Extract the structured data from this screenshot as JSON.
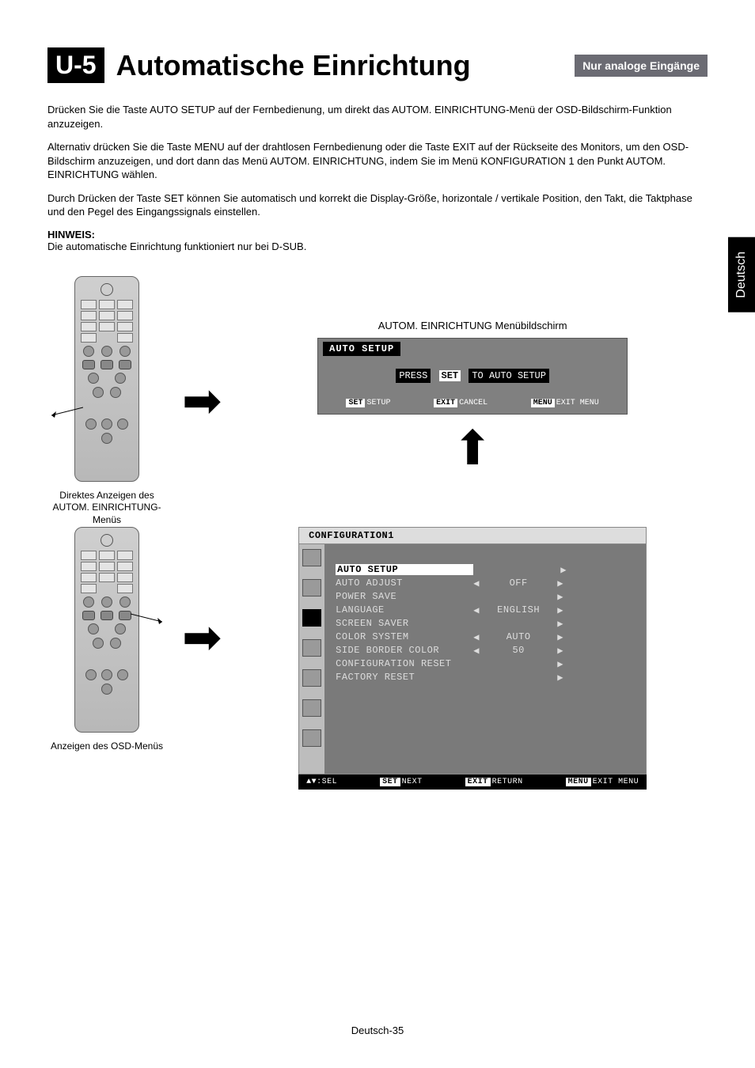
{
  "section_number": "U-5",
  "page_title": "Automatische Einrichtung",
  "tag": "Nur analoge Eingänge",
  "side_tab": "Deutsch",
  "paragraphs": [
    "Drücken Sie die Taste AUTO SETUP auf der Fernbedienung, um direkt das AUTOM. EINRICHTUNG-Menü der OSD-Bildschirm-Funktion anzuzeigen.",
    "Alternativ drücken Sie die Taste MENU auf der drahtlosen Fernbedienung oder die Taste EXIT auf der Rückseite des Monitors, um den OSD-Bildschirm anzuzeigen, und dort dann das Menü AUTOM. EINRICHTUNG, indem Sie im Menü KONFIGURATION 1 den Punkt AUTOM. EINRICHTUNG wählen.",
    "Durch Drücken der Taste SET können Sie automatisch und korrekt die Display-Größe, horizontale / vertikale Position, den Takt, die Taktphase und den Pegel des Eingangssignals einstellen."
  ],
  "notice_label": "HINWEIS:",
  "notice_text": "Die automatische Einrichtung funktioniert nur bei D-SUB.",
  "remote1_caption": "Direktes Anzeigen des AUTOM. EINRICHTUNG-Menüs",
  "remote2_caption": "Anzeigen des OSD-Menüs",
  "osd1_caption": "AUTOM. EINRICHTUNG Menübildschirm",
  "osd1": {
    "title": "AUTO SETUP",
    "body_press": "PRESS",
    "body_set": "SET",
    "body_to": "TO AUTO SETUP",
    "foot_set": "SET",
    "foot_set_lbl": "SETUP",
    "foot_exit": "EXIT",
    "foot_exit_lbl": "CANCEL",
    "foot_menu": "MENU",
    "foot_menu_lbl": "EXIT MENU"
  },
  "osd2": {
    "title": "CONFIGURATION1",
    "rows": [
      {
        "label": "AUTO SETUP",
        "left": "",
        "value": "",
        "right": "▶",
        "first": true
      },
      {
        "label": "AUTO ADJUST",
        "left": "◀",
        "value": "OFF",
        "right": "▶"
      },
      {
        "label": "POWER SAVE",
        "left": "",
        "value": "",
        "right": "▶"
      },
      {
        "label": "LANGUAGE",
        "left": "◀",
        "value": "ENGLISH",
        "right": "▶"
      },
      {
        "label": "SCREEN SAVER",
        "left": "",
        "value": "",
        "right": "▶"
      },
      {
        "label": "COLOR SYSTEM",
        "left": "◀",
        "value": "AUTO",
        "right": "▶"
      },
      {
        "label": "SIDE BORDER COLOR",
        "left": "◀",
        "value": "50",
        "right": "▶"
      },
      {
        "label": "CONFIGURATION RESET",
        "left": "",
        "value": "",
        "right": "▶"
      },
      {
        "label": "FACTORY RESET",
        "left": "",
        "value": "",
        "right": "▶"
      }
    ],
    "footer": {
      "sel_icon": "▲▼",
      "sel_lbl": "SEL",
      "set": "SET",
      "set_lbl": "NEXT",
      "exit": "EXIT",
      "exit_lbl": "RETURN",
      "menu": "MENU",
      "menu_lbl": "EXIT MENU"
    }
  },
  "page_footer": "Deutsch-35"
}
